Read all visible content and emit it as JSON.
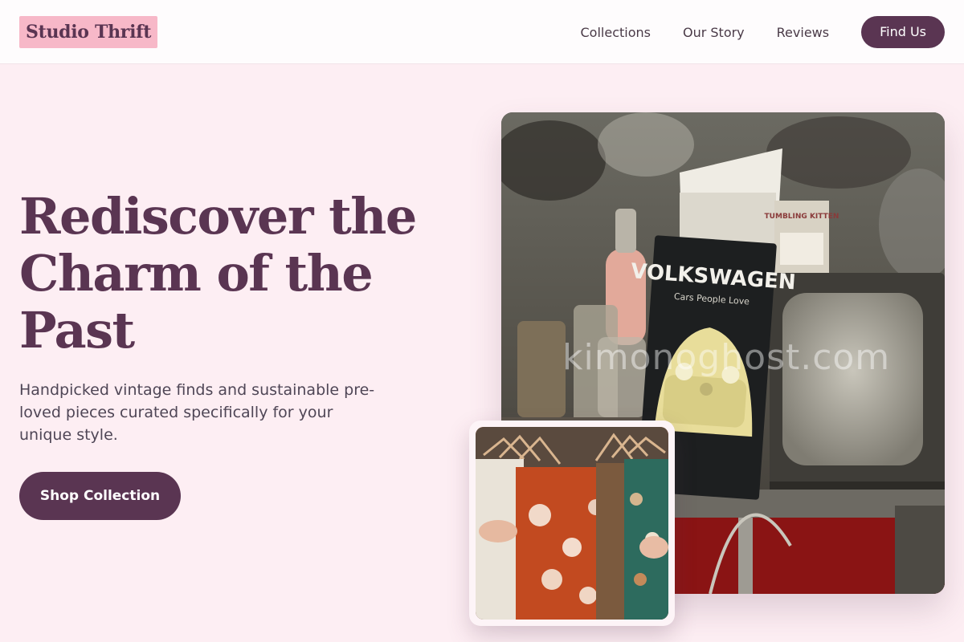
{
  "header": {
    "logo": "Studio Thrift",
    "nav": [
      {
        "label": "Collections"
      },
      {
        "label": "Our Story"
      },
      {
        "label": "Reviews"
      }
    ],
    "cta_label": "Find Us"
  },
  "hero": {
    "title": "Rediscover the Charm of the Past",
    "subtitle": "Handpicked vintage finds and sustainable pre-loved pieces curated specifically for your unique style.",
    "cta_label": "Shop Collection"
  },
  "images": {
    "main_alt": "Flea market stall with a vintage television and a Volkswagen book",
    "main_book_title": "VOLKSWAGEN",
    "main_book_subtitle": "Cars People Love",
    "main_box_label": "TUMBLING KITTEN",
    "watermark": "kimonoghost.com",
    "small_alt": "Rack of patterned vintage clothing on wooden hangers"
  },
  "colors": {
    "brand": "#5a3552",
    "accent": "#f7b8c8",
    "background": "#fdeef3"
  }
}
